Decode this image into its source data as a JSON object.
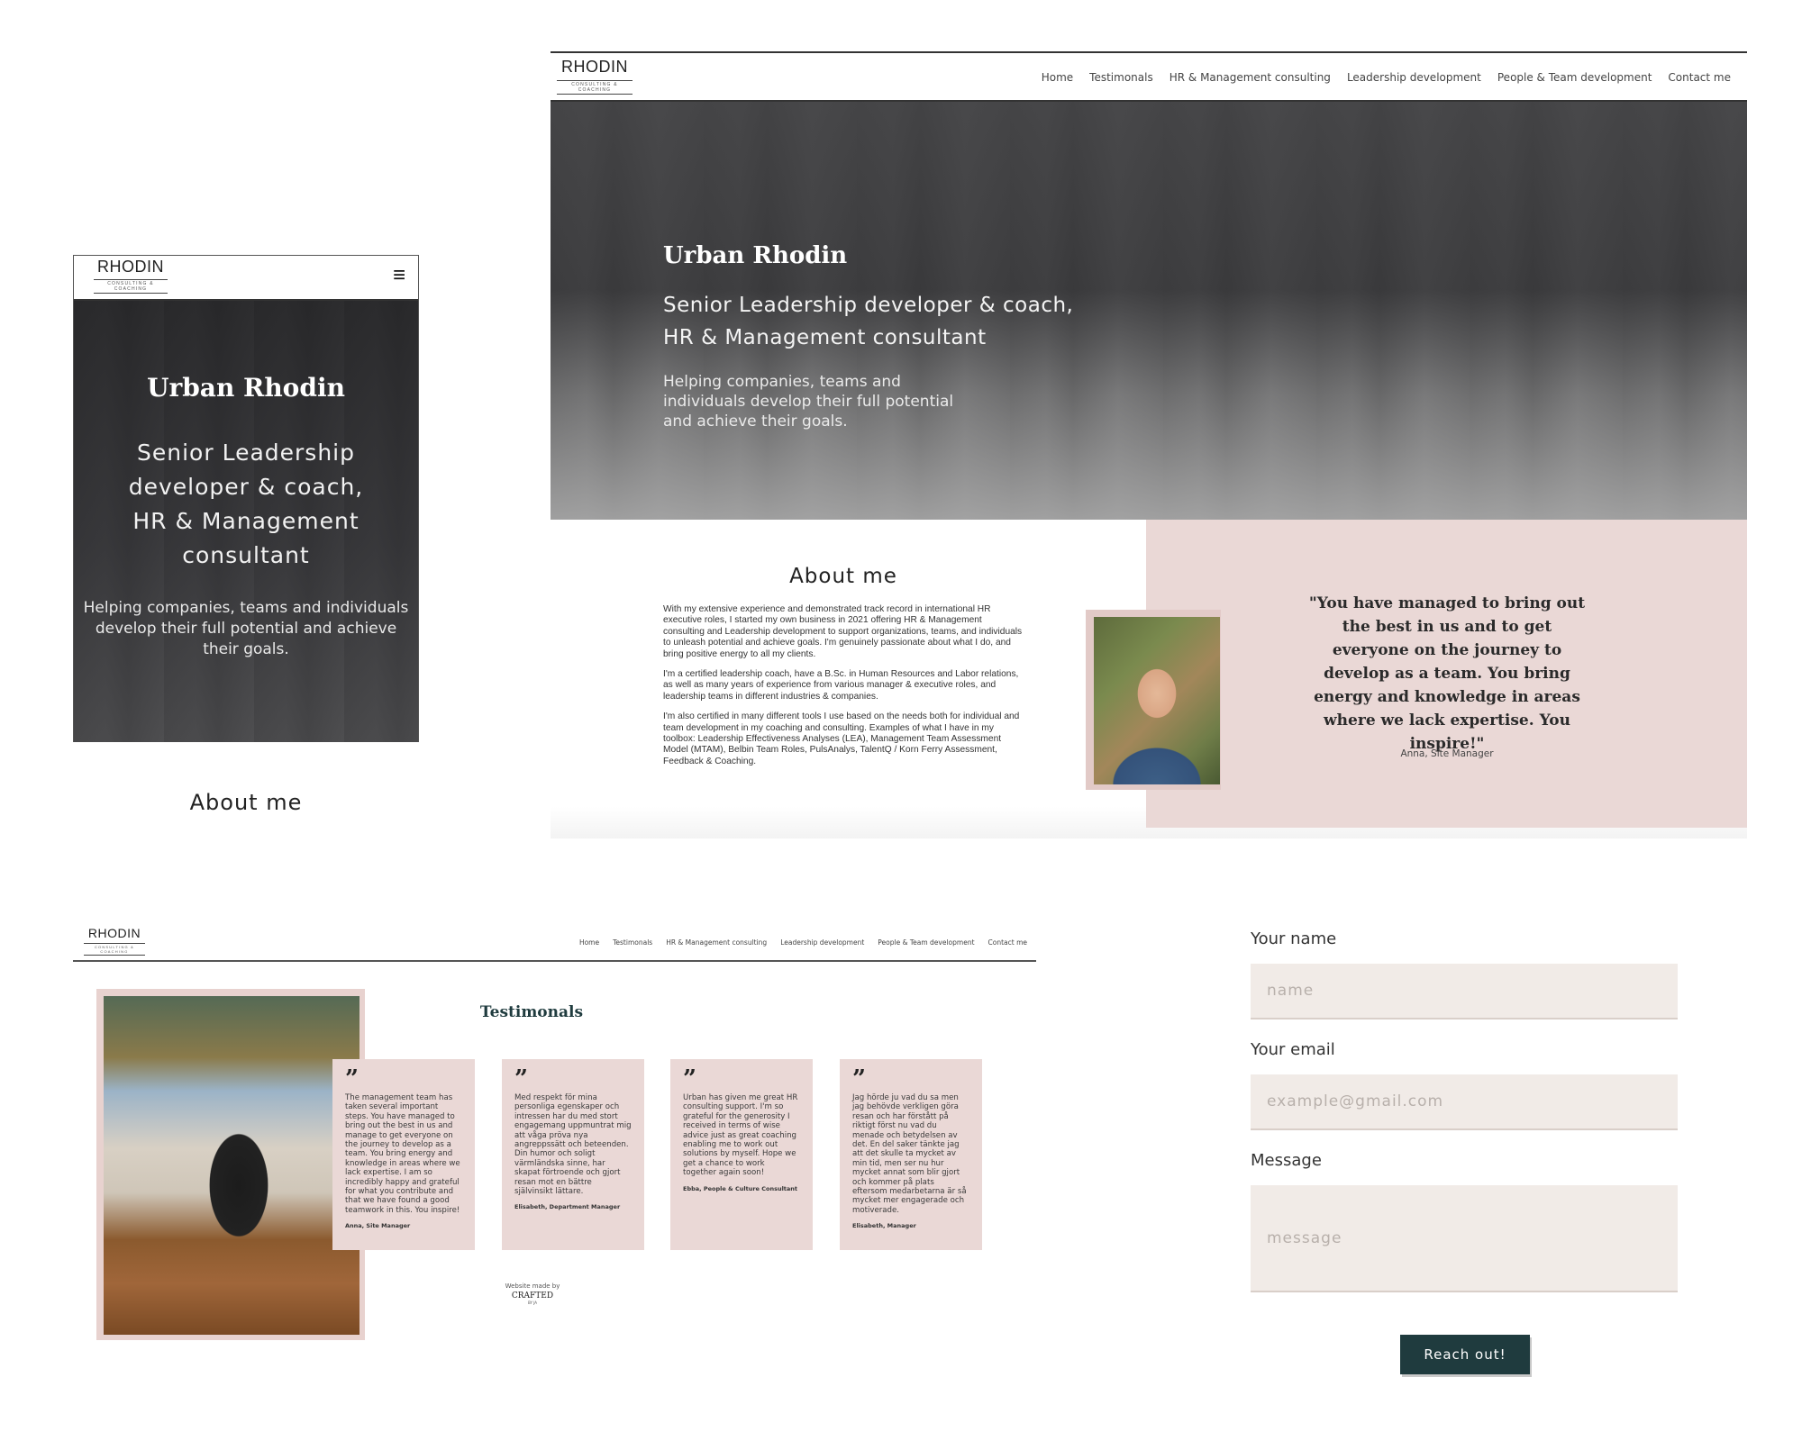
{
  "brand": {
    "name": "RHODIN",
    "tagline": "CONSULTING & COACHING"
  },
  "nav": {
    "items": [
      "Home",
      "Testimonals",
      "HR & Management consulting",
      "Leadership development",
      "People & Team development",
      "Contact me"
    ]
  },
  "hero": {
    "name": "Urban Rhodin",
    "title_line1": "Senior Leadership developer & coach,",
    "title_line2": "HR & Management consultant",
    "tagline_line1": "Helping companies, teams and",
    "tagline_line2": "individuals develop their full potential",
    "tagline_line3": "and achieve their goals."
  },
  "mobile": {
    "menu_icon": "≡",
    "title_line1": "Senior Leadership",
    "title_line2": "developer & coach,",
    "title_line3": "HR & Management",
    "title_line4": "consultant",
    "tagline_line1": "Helping companies, teams and individuals",
    "tagline_line2": "develop their full potential and achieve",
    "tagline_line3": "their goals.",
    "about_heading": "About me"
  },
  "about": {
    "heading": "About me",
    "p1": "With my extensive experience and demonstrated track record in international HR executive roles, I started my own business in 2021 offering HR & Management consulting and Leadership development to support organizations, teams, and individuals to unleash potential and achieve goals. I'm genuinely passionate about what I do, and bring positive energy to all my clients.",
    "p2": "I'm a certified leadership coach, have a B.Sc. in Human Resources and Labor relations, as well as many years of experience from various manager & executive roles, and leadership teams in different industries & companies.",
    "p3": "I'm also certified in many different tools I use based on the needs both for individual and team development in my coaching and consulting. Examples of what I have in my toolbox: Leadership Effectiveness Analyses (LEA), Management Team Assessment Model (MTAM), Belbin Team Roles, PulsAnalys, TalentQ / Korn Ferry Assessment, Feedback & Coaching.",
    "quote": "\"You have managed to bring out the best in us and to get everyone on the journey to develop as a team. You bring energy and knowledge in areas where we lack expertise. You inspire!\"",
    "quote_author": "Anna, Site Manager"
  },
  "testimonials": {
    "heading": "Testimonals",
    "quote_glyph": "”",
    "cards": [
      {
        "text": "The management team has taken several important steps. You have managed to bring out the best in us and manage to get everyone on the journey to develop as a team. You bring energy and knowledge in areas where we lack expertise. I am so incredibly happy and grateful for what you contribute and that we have found a good teamwork in this. You inspire!",
        "author": "Anna, Site Manager"
      },
      {
        "text": "Med respekt för mina personliga egenskaper och intressen har du med stort engagemang uppmuntrat mig att våga pröva nya angreppssätt och beteenden. Din humor och soligt värmländska sinne, har skapat förtroende och gjort resan mot en bättre självinsikt lättare.",
        "author": "Elisabeth, Department Manager"
      },
      {
        "text": "Urban has given me great HR consulting support. I'm so grateful for the generosity I received in terms of wise advice just as great coaching enabling me to work out solutions by myself. Hope we get a chance to work together again soon!",
        "author": "Ebba, People & Culture Consultant"
      },
      {
        "text": "Jag hörde ju vad du sa men jag behövde verkligen göra resan och har förstått på riktigt först nu vad du menade och betydelsen av det. En del saker tänkte jag att det skulle ta mycket av min tid, men ser nu hur mycket annat som blir gjort och kommer på plats eftersom medarbetarna är så mycket mer engagerade och motiverade.",
        "author": "Elisabeth, Manager"
      }
    ],
    "footer_line1": "Website made by",
    "footer_logo": "CRAFTED",
    "footer_logo_sub": "BY JA"
  },
  "contact": {
    "name_label": "Your name",
    "name_placeholder": "name",
    "email_label": "Your email",
    "email_placeholder": "example@gmail.com",
    "message_label": "Message",
    "message_placeholder": "message",
    "submit_label": "Reach out!"
  },
  "colors": {
    "pink": "#ead8d6",
    "dark_teal": "#1f3b3e",
    "field_bg": "#f1ebe7"
  }
}
